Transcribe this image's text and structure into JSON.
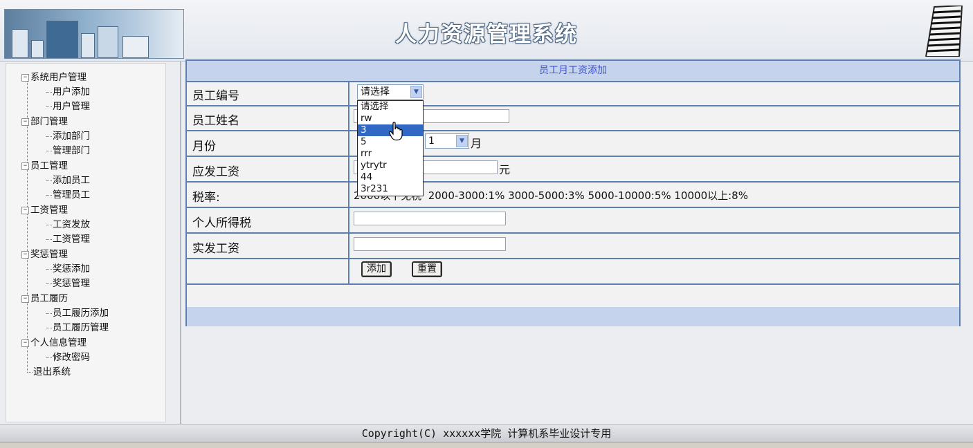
{
  "header": {
    "title": "人力资源管理系统"
  },
  "sidebar": {
    "groups": [
      {
        "label": "系统用户管理",
        "items": [
          "用户添加",
          "用户管理"
        ]
      },
      {
        "label": "部门管理",
        "items": [
          "添加部门",
          "管理部门"
        ]
      },
      {
        "label": "员工管理",
        "items": [
          "添加员工",
          "管理员工"
        ]
      },
      {
        "label": "工资管理",
        "items": [
          "工资发放",
          "工资管理"
        ]
      },
      {
        "label": "奖惩管理",
        "items": [
          "奖惩添加",
          "奖惩管理"
        ]
      },
      {
        "label": "员工履历",
        "items": [
          "员工履历添加",
          "员工履历管理"
        ]
      },
      {
        "label": "个人信息管理",
        "items": [
          "修改密码"
        ]
      }
    ],
    "logout": "退出系统",
    "expanded_symbol": "−"
  },
  "form": {
    "title": "员工月工资添加",
    "labels": {
      "employee_id": "员工编号",
      "employee_name": "员工姓名",
      "month": "月份",
      "gross_salary": "应发工资",
      "tax_rate": "税率:",
      "income_tax": "个人所得税",
      "net_salary": "实发工资"
    },
    "employee_select": {
      "value": "请选择"
    },
    "month_select": {
      "value": "1",
      "unit": "月"
    },
    "gross_salary_unit": "元",
    "tax_rate_text": "2000以下免税  2000-3000:1% 3000-5000:3% 5000-10000:5% 10000以上:8%",
    "buttons": {
      "submit": "添加",
      "reset": "重置"
    }
  },
  "dropdown": {
    "options": [
      "请选择",
      "rw",
      "3",
      "5",
      "rrr",
      "ytrytr",
      "44",
      "3r231"
    ],
    "selected_index": 2
  },
  "footer": {
    "copyright": "Copyright(C) xxxxxx学院 计算机系毕业设计专用"
  }
}
